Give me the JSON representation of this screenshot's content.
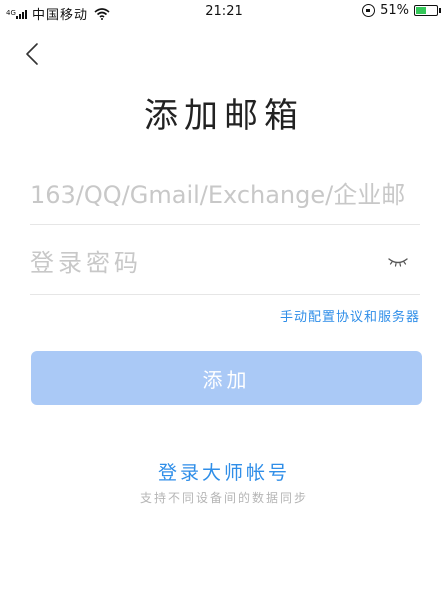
{
  "status_bar": {
    "network": "4G",
    "carrier": "中国移动",
    "time": "21:21",
    "battery_percent": "51%",
    "battery_level": 0.51,
    "battery_color": "#34c759"
  },
  "header": {
    "back_icon": "chevron-left-icon",
    "title": "添加邮箱"
  },
  "form": {
    "email_placeholder": "163/QQ/Gmail/Exchange/企业邮",
    "email_value": "",
    "password_placeholder": "登录密码",
    "password_value": "",
    "password_toggle_icon": "eye-closed-icon",
    "manual_config_label": "手动配置协议和服务器",
    "add_button_label": "添加"
  },
  "master_login": {
    "label": "登录大师帐号",
    "subtitle": "支持不同设备间的数据同步"
  },
  "colors": {
    "accent": "#2f8ee8",
    "button_disabled": "#aac9f6",
    "placeholder": "#c8c8c8"
  }
}
